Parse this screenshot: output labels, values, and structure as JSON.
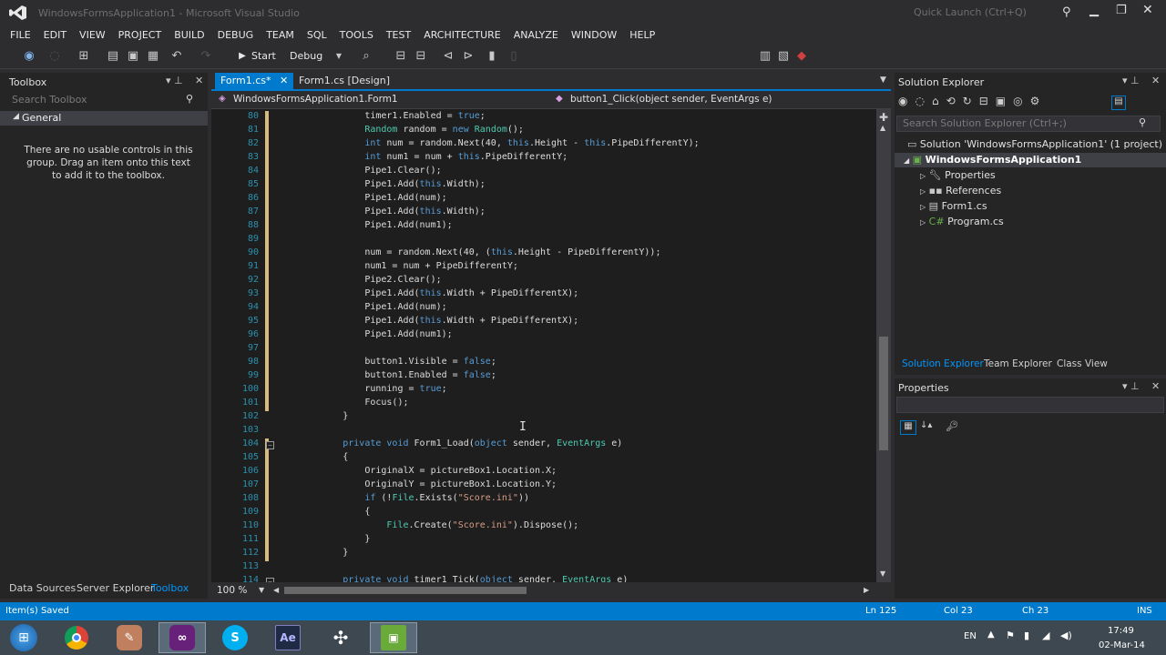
{
  "window": {
    "title": "WindowsFormsApplication1 - Microsoft Visual Studio",
    "quick_launch_placeholder": "Quick Launch (Ctrl+Q)"
  },
  "menu": [
    "FILE",
    "EDIT",
    "VIEW",
    "PROJECT",
    "BUILD",
    "DEBUG",
    "TEAM",
    "SQL",
    "TOOLS",
    "TEST",
    "ARCHITECTURE",
    "ANALYZE",
    "WINDOW",
    "HELP"
  ],
  "toolbar": {
    "start_label": "Start",
    "config_label": "Debug"
  },
  "toolbox": {
    "title": "Toolbox",
    "search_placeholder": "Search Toolbox",
    "group": "General",
    "empty_message": "There are no usable controls in this group. Drag an item onto this text to add it to the toolbox.",
    "bottom_tabs": [
      "Data Sources",
      "Server Explorer",
      "Toolbox"
    ]
  },
  "editor": {
    "tabs": [
      "Form1.cs*",
      "Form1.cs [Design]"
    ],
    "nav_class": "WindowsFormsApplication1.Form1",
    "nav_member": "button1_Click(object sender, EventArgs e)",
    "zoom": "100 %",
    "lines": [
      {
        "n": "80",
        "t": [
          [
            "",
            "                timer1.Enabled = "
          ],
          [
            "kw",
            "true"
          ],
          [
            "",
            ";"
          ]
        ]
      },
      {
        "n": "81",
        "t": [
          [
            "ty",
            "                Random"
          ],
          [
            "",
            " random = "
          ],
          [
            "kw",
            "new"
          ],
          [
            "ty",
            " Random"
          ],
          [
            "",
            "();"
          ]
        ]
      },
      {
        "n": "82",
        "t": [
          [
            "kw",
            "                int"
          ],
          [
            "",
            " num = random.Next(40, "
          ],
          [
            "kw",
            "this"
          ],
          [
            "",
            ".Height - "
          ],
          [
            "kw",
            "this"
          ],
          [
            "",
            ".PipeDifferentY);"
          ]
        ]
      },
      {
        "n": "83",
        "t": [
          [
            "kw",
            "                int"
          ],
          [
            "",
            " num1 = num + "
          ],
          [
            "kw",
            "this"
          ],
          [
            "",
            ".PipeDifferentY;"
          ]
        ]
      },
      {
        "n": "84",
        "t": [
          [
            "",
            "                Pipe1.Clear();"
          ]
        ]
      },
      {
        "n": "85",
        "t": [
          [
            "",
            "                Pipe1.Add("
          ],
          [
            "kw",
            "this"
          ],
          [
            "",
            ".Width);"
          ]
        ]
      },
      {
        "n": "86",
        "t": [
          [
            "",
            "                Pipe1.Add(num);"
          ]
        ]
      },
      {
        "n": "87",
        "t": [
          [
            "",
            "                Pipe1.Add("
          ],
          [
            "kw",
            "this"
          ],
          [
            "",
            ".Width);"
          ]
        ]
      },
      {
        "n": "88",
        "t": [
          [
            "",
            "                Pipe1.Add(num1);"
          ]
        ]
      },
      {
        "n": "89",
        "t": [
          [
            "",
            ""
          ]
        ]
      },
      {
        "n": "90",
        "t": [
          [
            "",
            "                num = random.Next(40, ("
          ],
          [
            "kw",
            "this"
          ],
          [
            "",
            ".Height - PipeDifferentY));"
          ]
        ]
      },
      {
        "n": "91",
        "t": [
          [
            "",
            "                num1 = num + PipeDifferentY;"
          ]
        ]
      },
      {
        "n": "92",
        "t": [
          [
            "",
            "                Pipe2.Clear();"
          ]
        ]
      },
      {
        "n": "93",
        "t": [
          [
            "",
            "                Pipe1.Add("
          ],
          [
            "kw",
            "this"
          ],
          [
            "",
            ".Width + PipeDifferentX);"
          ]
        ]
      },
      {
        "n": "94",
        "t": [
          [
            "",
            "                Pipe1.Add(num);"
          ]
        ]
      },
      {
        "n": "95",
        "t": [
          [
            "",
            "                Pipe1.Add("
          ],
          [
            "kw",
            "this"
          ],
          [
            "",
            ".Width + PipeDifferentX);"
          ]
        ]
      },
      {
        "n": "96",
        "t": [
          [
            "",
            "                Pipe1.Add(num1);"
          ]
        ]
      },
      {
        "n": "97",
        "t": [
          [
            "",
            ""
          ]
        ]
      },
      {
        "n": "98",
        "t": [
          [
            "",
            "                button1.Visible = "
          ],
          [
            "kw",
            "false"
          ],
          [
            "",
            ";"
          ]
        ]
      },
      {
        "n": "99",
        "t": [
          [
            "",
            "                button1.Enabled = "
          ],
          [
            "kw",
            "false"
          ],
          [
            "",
            ";"
          ]
        ]
      },
      {
        "n": "100",
        "t": [
          [
            "",
            "                running = "
          ],
          [
            "kw",
            "true"
          ],
          [
            "",
            ";"
          ]
        ]
      },
      {
        "n": "101",
        "t": [
          [
            "",
            "                Focus();"
          ]
        ]
      },
      {
        "n": "102",
        "t": [
          [
            "",
            "            }"
          ]
        ]
      },
      {
        "n": "103",
        "t": [
          [
            "",
            ""
          ]
        ]
      },
      {
        "n": "104",
        "t": [
          [
            "kw",
            "            private void"
          ],
          [
            "",
            " Form1_Load("
          ],
          [
            "kw",
            "object"
          ],
          [
            "",
            " sender, "
          ],
          [
            "ty",
            "EventArgs"
          ],
          [
            "",
            " e)"
          ]
        ]
      },
      {
        "n": "105",
        "t": [
          [
            "",
            "            {"
          ]
        ]
      },
      {
        "n": "106",
        "t": [
          [
            "",
            "                OriginalX = pictureBox1.Location.X;"
          ]
        ]
      },
      {
        "n": "107",
        "t": [
          [
            "",
            "                OriginalY = pictureBox1.Location.Y;"
          ]
        ]
      },
      {
        "n": "108",
        "t": [
          [
            "kw",
            "                if"
          ],
          [
            "",
            " (!"
          ],
          [
            "ty",
            "File"
          ],
          [
            "",
            ".Exists("
          ],
          [
            "st",
            "\"Score.ini\""
          ],
          [
            "",
            "))"
          ]
        ]
      },
      {
        "n": "109",
        "t": [
          [
            "",
            "                {"
          ]
        ]
      },
      {
        "n": "110",
        "t": [
          [
            "ty",
            "                    File"
          ],
          [
            "",
            ".Create("
          ],
          [
            "st",
            "\"Score.ini\""
          ],
          [
            "",
            ").Dispose();"
          ]
        ]
      },
      {
        "n": "111",
        "t": [
          [
            "",
            "                }"
          ]
        ]
      },
      {
        "n": "112",
        "t": [
          [
            "",
            "            }"
          ]
        ]
      },
      {
        "n": "113",
        "t": [
          [
            "",
            ""
          ]
        ]
      },
      {
        "n": "114",
        "t": [
          [
            "kw",
            "            private void"
          ],
          [
            "",
            " timer1_Tick("
          ],
          [
            "kw",
            "object"
          ],
          [
            "",
            " sender, "
          ],
          [
            "ty",
            "EventArgs"
          ],
          [
            "",
            " e)"
          ]
        ]
      }
    ]
  },
  "solution_explorer": {
    "title": "Solution Explorer",
    "search_placeholder": "Search Solution Explorer (Ctrl+;)",
    "solution": "Solution 'WindowsFormsApplication1' (1 project)",
    "project": "WindowsFormsApplication1",
    "items": [
      "Properties",
      "References",
      "Form1.cs",
      "Program.cs"
    ],
    "bottom_tabs": [
      "Solution Explorer",
      "Team Explorer",
      "Class View"
    ]
  },
  "properties": {
    "title": "Properties"
  },
  "status": {
    "message": "Item(s) Saved",
    "ln": "Ln 125",
    "col": "Col 23",
    "ch": "Ch 23",
    "mode": "INS"
  },
  "taskbar": {
    "lang": "EN",
    "time": "17:49",
    "date": "02-Mar-14"
  },
  "colors": {
    "accent": "#007acc",
    "keyword": "#569cd6",
    "type": "#4ec9b0",
    "string": "#d69d85"
  }
}
